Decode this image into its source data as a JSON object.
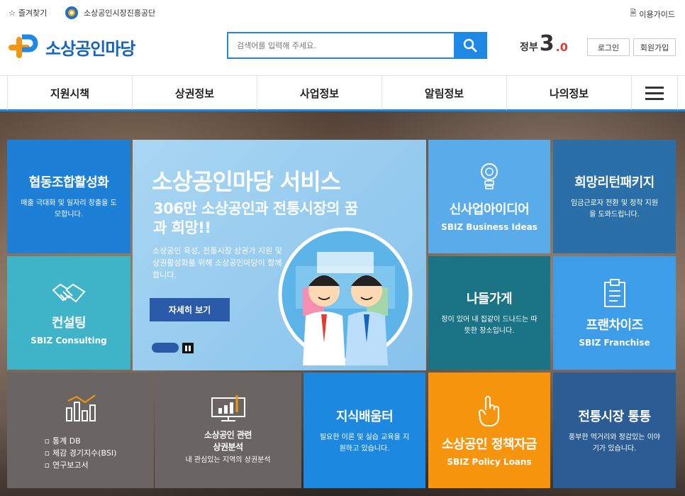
{
  "util": {
    "favorites": "즐겨찾기",
    "org_name": "소상공인시장진흥공단",
    "guide": "이용가이드"
  },
  "header": {
    "site_name": "소상공인마당",
    "search_placeholder": "검색어를 입력해 주세요.",
    "gov_text": "정부",
    "gov_number": "3",
    "gov_decimal": ".0",
    "login": "로그인",
    "join": "회원가입"
  },
  "nav": [
    "지원시책",
    "상권정보",
    "사업정보",
    "알림정보",
    "나의정보"
  ],
  "banner": {
    "title": "소상공인마당 서비스",
    "subtitle": "306만 소상공인과 전통시장의 꿈과 희망!!",
    "description": "소상공인 육성, 전통시장 상권가 지원 및 상권활성화를 위해 소상공인마당이 함께합니다.",
    "button": "자세히 보기"
  },
  "tiles": {
    "coop": {
      "title": "협동조합활성화",
      "desc": "매출 극대화 및 일자리 창출을 도모합니다."
    },
    "consult": {
      "title": "컨설팅",
      "en": "SBIZ Consulting"
    },
    "idea": {
      "title": "신사업아이디어",
      "en": "SBIZ Business Ideas"
    },
    "hope": {
      "title": "희망리턴패키지",
      "desc": "임금근로자 전환 및 정착 지원을 도와드립니다."
    },
    "nadeul": {
      "title": "나들가게",
      "desc": "정이 있어 내 집같이 드나드는 따뜻한 장소입니다."
    },
    "franchise": {
      "title": "프랜차이즈",
      "en": "SBIZ Franchise"
    },
    "stats": {
      "items": [
        "통계 DB",
        "체감 경기지수(BSI)",
        "연구보고서"
      ]
    },
    "market": {
      "title1": "소상공인 관련",
      "title2": "상권분석",
      "desc": "내 관심있는 지역의 상권분석"
    },
    "knowledge": {
      "title": "지식배움터",
      "desc": "필요한 이론 및 실습 교육을 지원하고 있습니다."
    },
    "policy": {
      "title": "소상공인 정책자금",
      "en": "SBIZ Policy Loans"
    },
    "trad": {
      "title": "전통시장 통통",
      "desc": "풍부한 먹거리와 정감있는 이야기가 있습니다."
    }
  },
  "colors": {
    "accent": "#1e88e5",
    "brand_orange": "#f7950f"
  }
}
